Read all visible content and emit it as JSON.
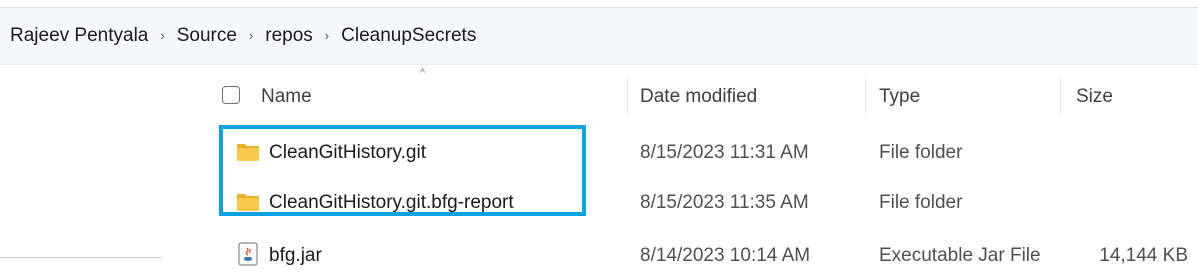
{
  "breadcrumb": {
    "items": [
      "Rajeev Pentyala",
      "Source",
      "repos",
      "CleanupSecrets"
    ],
    "separator": "›"
  },
  "columns": {
    "name": "Name",
    "date_modified": "Date modified",
    "type": "Type",
    "size": "Size",
    "sort_indicator": "^"
  },
  "rows": [
    {
      "name": "CleanGitHistory.git",
      "date_modified": "8/15/2023 11:31 AM",
      "type": "File folder",
      "size": "",
      "icon": "folder-icon"
    },
    {
      "name": "CleanGitHistory.git.bfg-report",
      "date_modified": "8/15/2023 11:35 AM",
      "type": "File folder",
      "size": "",
      "icon": "folder-icon"
    },
    {
      "name": "bfg.jar",
      "date_modified": "8/14/2023 10:14 AM",
      "type": "Executable Jar File",
      "size": "14,144 KB",
      "icon": "java-jar-icon"
    }
  ],
  "colors": {
    "highlight": "#0aa2e0",
    "folder": "#f8c94a",
    "breadcrumb_bg": "#f6f8fb"
  }
}
